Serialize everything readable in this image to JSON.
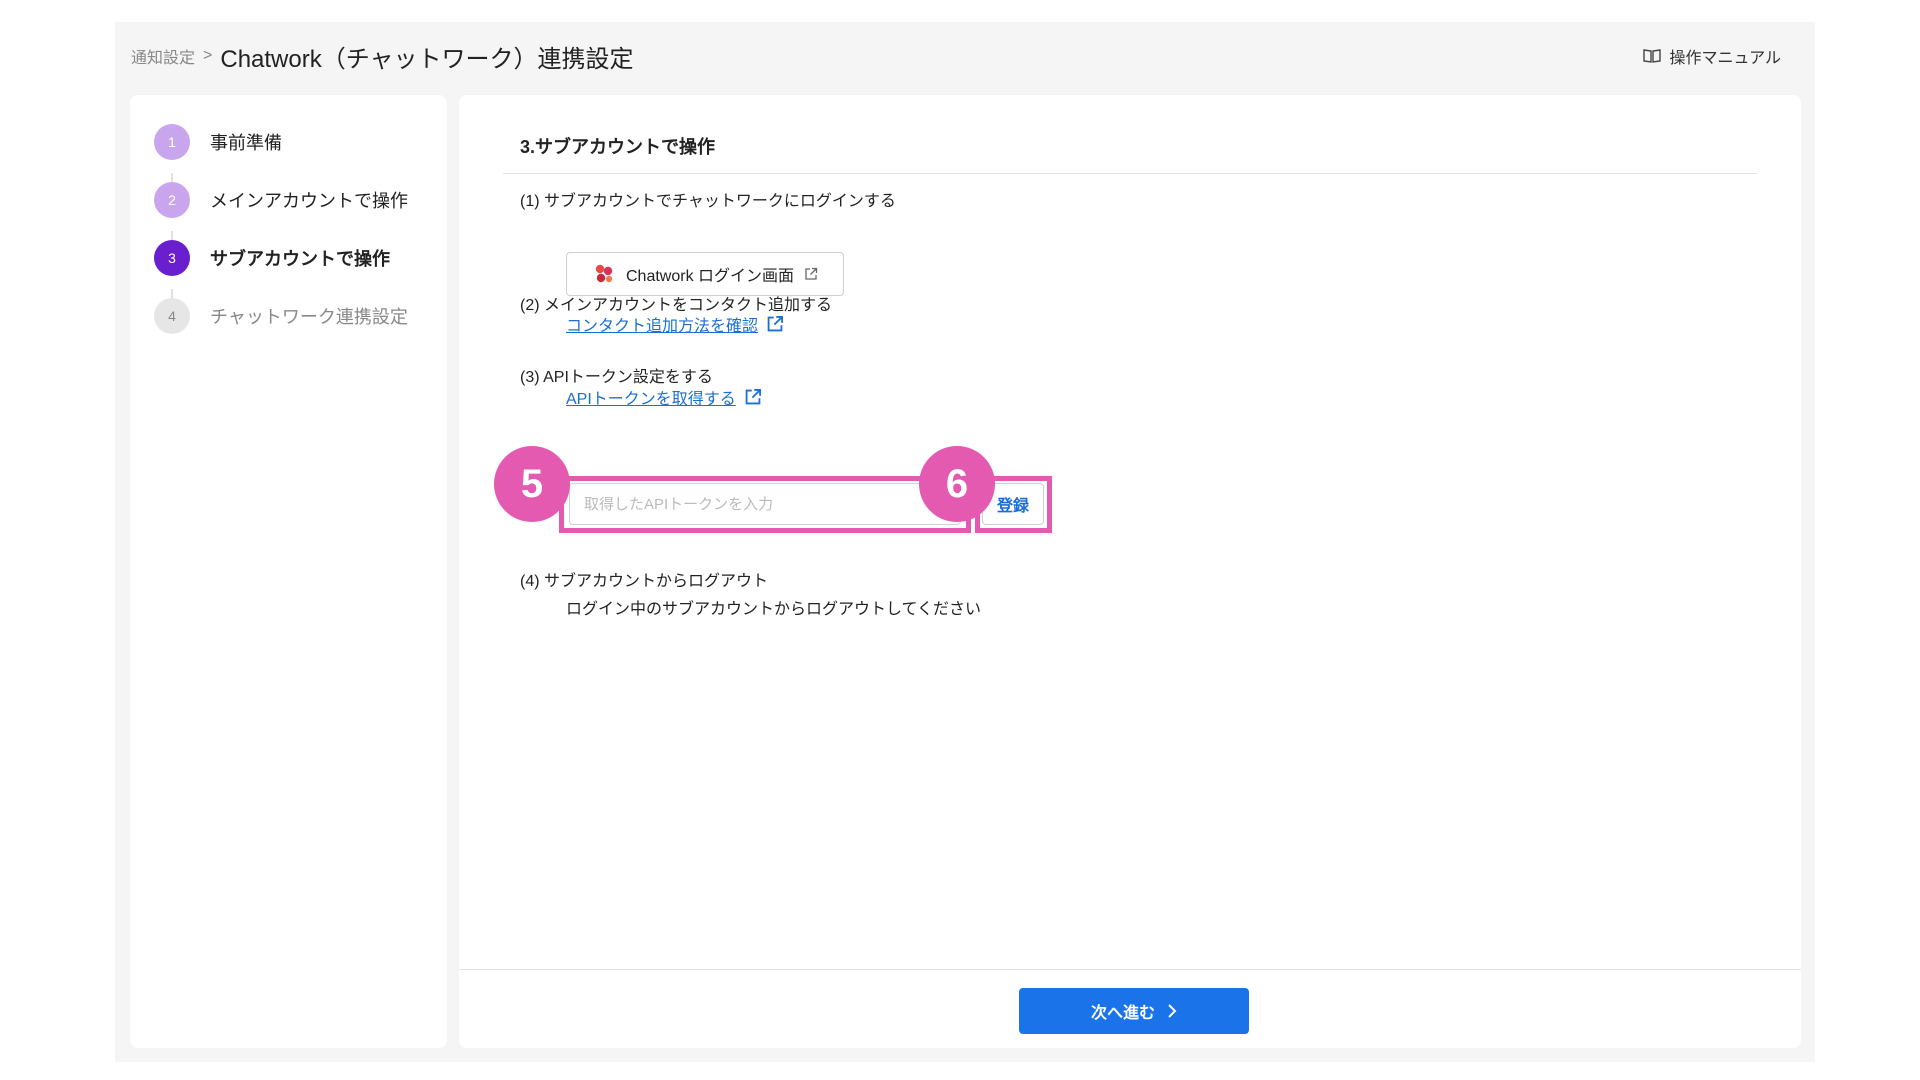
{
  "header": {
    "breadcrumb_parent": "通知設定",
    "breadcrumb_sep": ">",
    "title": "Chatwork（チャットワーク）連携設定",
    "manual_label": "操作マニュアル",
    "manual_icon": "book-icon"
  },
  "steps": [
    {
      "num": "1",
      "label": "事前準備",
      "state": "done"
    },
    {
      "num": "2",
      "label": "メインアカウントで操作",
      "state": "done"
    },
    {
      "num": "3",
      "label": "サブアカウントで操作",
      "state": "active"
    },
    {
      "num": "4",
      "label": "チャットワーク連携設定",
      "state": "todo"
    }
  ],
  "main": {
    "section_title": "3.サブアカウントで操作",
    "item1": {
      "title": "(1) サブアカウントでチャットワークにログインする",
      "button_label": "Chatwork ログイン画面"
    },
    "item2": {
      "title": "(2) メインアカウントをコンタクト追加する",
      "link": "コンタクト追加方法を確認"
    },
    "item3": {
      "title": "(3) APIトークン設定をする",
      "link": "APIトークンを取得する",
      "input_placeholder": "取得したAPIトークンを入力",
      "input_value": "",
      "register_label": "登録"
    },
    "item4": {
      "title": "(4) サブアカウントからログアウト",
      "note": "ログイン中のサブアカウントからログアウトしてください"
    }
  },
  "annotations": {
    "badge5": "5",
    "badge6": "6",
    "color": "#e35ab0"
  },
  "footer": {
    "next_label": "次へ進む"
  },
  "colors": {
    "accent": "#1a73e8",
    "step_active": "#6a1fcf",
    "step_done": "#c9a5ee"
  }
}
